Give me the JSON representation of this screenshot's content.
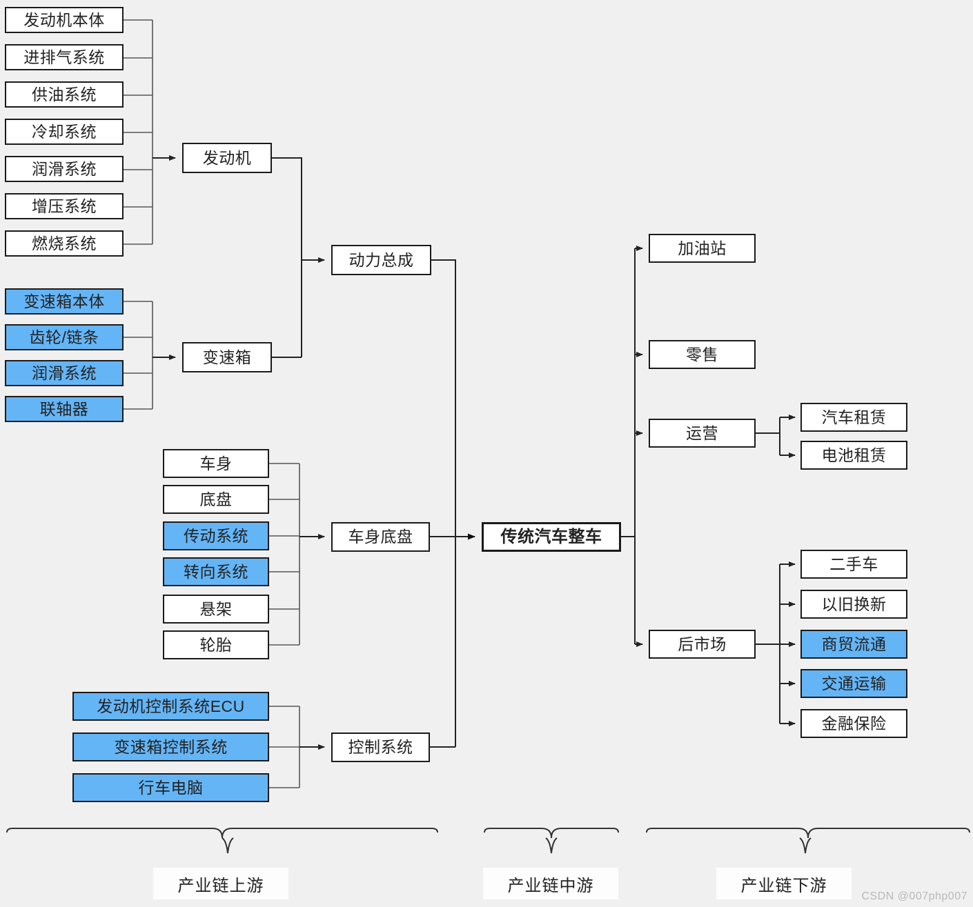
{
  "diagram": {
    "title_node": "传统汽车整车",
    "background_color": "#f0f0f0",
    "highlight_color": "#64b5f6",
    "box_color": "#ffffff",
    "line_color": "#333333"
  },
  "engine_group": {
    "items": [
      {
        "label": "发动机本体",
        "highlight": false
      },
      {
        "label": "进排气系统",
        "highlight": false
      },
      {
        "label": "供油系统",
        "highlight": false
      },
      {
        "label": "冷却系统",
        "highlight": false
      },
      {
        "label": "润滑系统",
        "highlight": false
      },
      {
        "label": "增压系统",
        "highlight": false
      },
      {
        "label": "燃烧系统",
        "highlight": false
      }
    ],
    "parent": "发动机"
  },
  "transmission_group": {
    "items": [
      {
        "label": "变速箱本体",
        "highlight": true
      },
      {
        "label": "齿轮/链条",
        "highlight": true
      },
      {
        "label": "润滑系统",
        "highlight": true
      },
      {
        "label": "联轴器",
        "highlight": true
      }
    ],
    "parent": "变速箱"
  },
  "powertrain": {
    "label": "动力总成"
  },
  "chassis_group": {
    "items": [
      {
        "label": "车身",
        "highlight": false
      },
      {
        "label": "底盘",
        "highlight": false
      },
      {
        "label": "传动系统",
        "highlight": true
      },
      {
        "label": "转向系统",
        "highlight": true
      },
      {
        "label": "悬架",
        "highlight": false
      },
      {
        "label": "轮胎",
        "highlight": false
      }
    ],
    "parent": "车身底盘"
  },
  "control_group": {
    "items": [
      {
        "label": "发动机控制系统ECU",
        "highlight": true
      },
      {
        "label": "变速箱控制系统",
        "highlight": true
      },
      {
        "label": "行车电脑",
        "highlight": true
      }
    ],
    "parent": "控制系统"
  },
  "downstream": {
    "items": [
      {
        "label": "加油站",
        "highlight": false
      },
      {
        "label": "零售",
        "highlight": false
      },
      {
        "label": "运营",
        "highlight": false
      },
      {
        "label": "后市场",
        "highlight": false
      }
    ],
    "operation_children": [
      {
        "label": "汽车租赁",
        "highlight": false
      },
      {
        "label": "电池租赁",
        "highlight": false
      }
    ],
    "aftermarket_children": [
      {
        "label": "二手车",
        "highlight": false
      },
      {
        "label": "以旧换新",
        "highlight": false
      },
      {
        "label": "商贸流通",
        "highlight": true
      },
      {
        "label": "交通运输",
        "highlight": true
      },
      {
        "label": "金融保险",
        "highlight": false
      }
    ]
  },
  "phases": [
    {
      "label": "产业链上游"
    },
    {
      "label": "产业链中游"
    },
    {
      "label": "产业链下游"
    }
  ],
  "watermark": {
    "text": "CSDN @007php007"
  }
}
